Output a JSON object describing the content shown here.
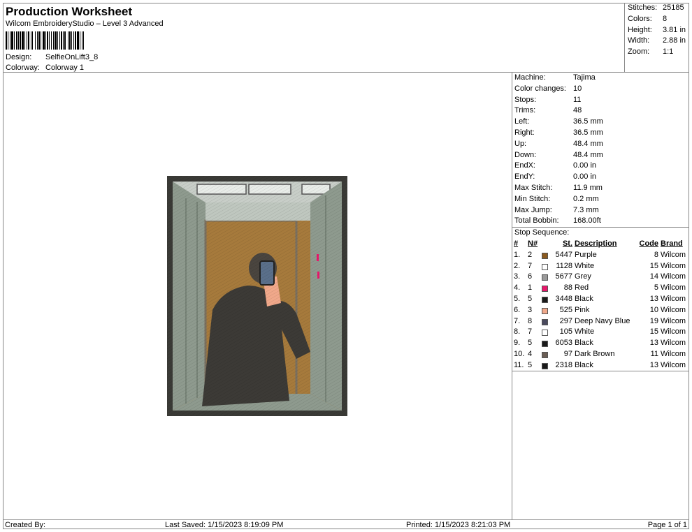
{
  "header": {
    "title": "Production Worksheet",
    "subtitle": "Wilcom EmbroideryStudio – Level 3 Advanced",
    "design_label": "Design:",
    "design_value": "SelfieOnLift3_8",
    "colorway_label": "Colorway:",
    "colorway_value": "Colorway 1"
  },
  "stats": [
    {
      "k": "Stitches:",
      "v": "25185"
    },
    {
      "k": "Colors:",
      "v": "8"
    },
    {
      "k": "Height:",
      "v": "3.81 in"
    },
    {
      "k": "Width:",
      "v": "2.88 in"
    },
    {
      "k": "Zoom:",
      "v": "1:1"
    }
  ],
  "machine_info": [
    {
      "k": "Machine:",
      "v": "Tajima"
    },
    {
      "k": "Color changes:",
      "v": "10"
    },
    {
      "k": "Stops:",
      "v": "11"
    },
    {
      "k": "Trims:",
      "v": "48"
    },
    {
      "k": "Left:",
      "v": "36.5 mm"
    },
    {
      "k": "Right:",
      "v": "36.5 mm"
    },
    {
      "k": "Up:",
      "v": "48.4 mm"
    },
    {
      "k": "Down:",
      "v": "48.4 mm"
    },
    {
      "k": "EndX:",
      "v": "0.00 in"
    },
    {
      "k": "EndY:",
      "v": "0.00 in"
    },
    {
      "k": "Max Stitch:",
      "v": "11.9 mm"
    },
    {
      "k": "Min Stitch:",
      "v": "0.2 mm"
    },
    {
      "k": "Max Jump:",
      "v": "7.3 mm"
    },
    {
      "k": "Total Bobbin:",
      "v": "168.00ft"
    }
  ],
  "stop_sequence": {
    "caption": "Stop Sequence:",
    "headers": [
      "#",
      "N#",
      "St.",
      "Description",
      "Code",
      "Brand"
    ],
    "rows": [
      {
        "idx": "1.",
        "n": "2",
        "color": "#8B5A1E",
        "st": "5447",
        "desc": "Purple",
        "code": "8",
        "brand": "Wilcom"
      },
      {
        "idx": "2.",
        "n": "7",
        "color": "#FFFFFF",
        "st": "1128",
        "desc": "White",
        "code": "15",
        "brand": "Wilcom"
      },
      {
        "idx": "3.",
        "n": "6",
        "color": "#9A9A9A",
        "st": "5677",
        "desc": "Grey",
        "code": "14",
        "brand": "Wilcom"
      },
      {
        "idx": "4.",
        "n": "1",
        "color": "#E8176B",
        "st": "88",
        "desc": "Red",
        "code": "5",
        "brand": "Wilcom"
      },
      {
        "idx": "5.",
        "n": "5",
        "color": "#1A1A1A",
        "st": "3448",
        "desc": "Black",
        "code": "13",
        "brand": "Wilcom"
      },
      {
        "idx": "6.",
        "n": "3",
        "color": "#F0A88A",
        "st": "525",
        "desc": "Pink",
        "code": "10",
        "brand": "Wilcom"
      },
      {
        "idx": "7.",
        "n": "8",
        "color": "#4A4A5E",
        "st": "297",
        "desc": "Deep Navy Blue",
        "code": "19",
        "brand": "Wilcom"
      },
      {
        "idx": "8.",
        "n": "7",
        "color": "#FFFFFF",
        "st": "105",
        "desc": "White",
        "code": "15",
        "brand": "Wilcom"
      },
      {
        "idx": "9.",
        "n": "5",
        "color": "#1A1A1A",
        "st": "6053",
        "desc": "Black",
        "code": "13",
        "brand": "Wilcom"
      },
      {
        "idx": "10.",
        "n": "4",
        "color": "#6B5E55",
        "st": "97",
        "desc": "Dark Brown",
        "code": "11",
        "brand": "Wilcom"
      },
      {
        "idx": "11.",
        "n": "5",
        "color": "#1A1A1A",
        "st": "2318",
        "desc": "Black",
        "code": "13",
        "brand": "Wilcom"
      }
    ]
  },
  "footer": {
    "created_by": "Created By:",
    "last_saved": "Last Saved: 1/15/2023 8:19:09 PM",
    "printed": "Printed: 1/15/2023 8:21:03 PM",
    "page": "Page 1 of 1"
  },
  "colors": {
    "border": "#888888",
    "frame": "#3A3A36",
    "wall": "#8E9A8E",
    "wood": "#A67A3C"
  }
}
